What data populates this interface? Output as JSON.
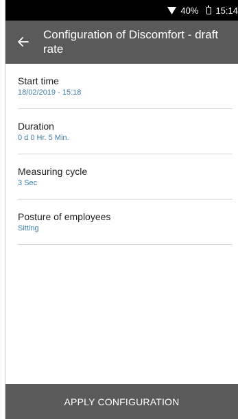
{
  "status_bar": {
    "battery_percent": "40%",
    "time": "15:14"
  },
  "app_bar": {
    "title": "Configuration of Discomfort - draft rate"
  },
  "settings": [
    {
      "label": "Start time",
      "value": "18/02/2019 - 15:18"
    },
    {
      "label": "Duration",
      "value": "0 d 0 Hr. 5 Min."
    },
    {
      "label": "Measuring cycle",
      "value": "3 Sec"
    },
    {
      "label": "Posture of employees",
      "value": "Sitting"
    }
  ],
  "footer": {
    "apply_label": "APPLY CONFIGURATION"
  },
  "colors": {
    "app_bar": "#5a5a5a",
    "value_text": "#3d7ea6",
    "status_bar": "#000000"
  }
}
